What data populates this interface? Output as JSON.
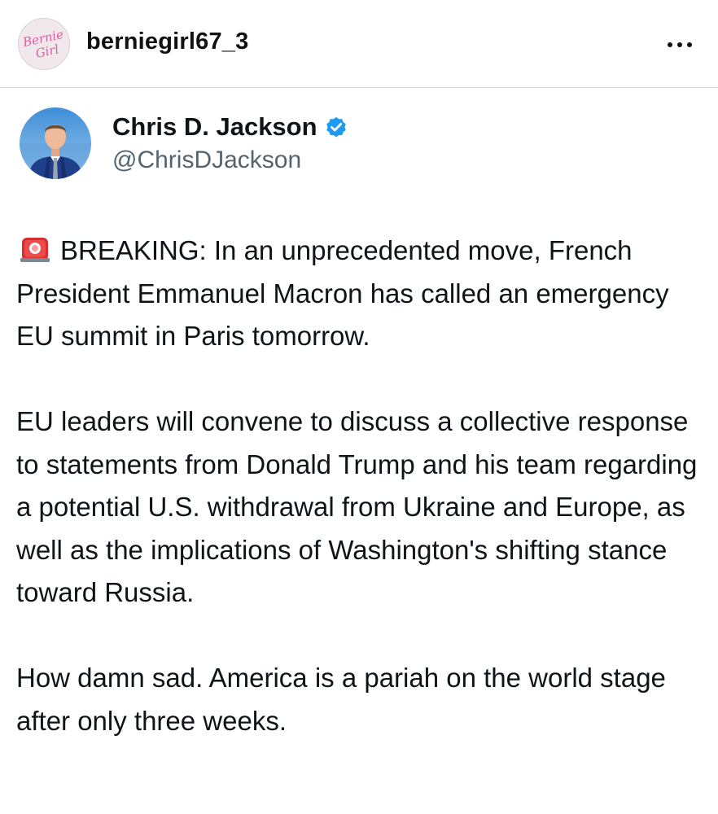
{
  "instagram": {
    "username": "berniegirl67_3",
    "avatar": {
      "text_line1": "Bernie",
      "text_line2": "Girl",
      "color": "#e25aa3"
    },
    "more_icon": "ellipsis-icon"
  },
  "tweet": {
    "author_name": "Chris D. Jackson",
    "verified_icon": "verified-badge-icon",
    "verified_color": "#1d9bf0",
    "handle": "@ChrisDJackson",
    "paragraph1": {
      "icon": "siren-icon",
      "text": "BREAKING: In an unprecedented move, French President Emmanuel Macron has called an emergency EU summit in Paris tomorrow."
    },
    "paragraph2": "EU leaders will convene to discuss a collective response to statements from Donald Trump and his team regarding a potential U.S. withdrawal from Ukraine and Europe, as well as the implications of Washington's shifting stance toward Russia.",
    "paragraph3": "How damn sad. America is a pariah on the world stage after only three weeks."
  }
}
